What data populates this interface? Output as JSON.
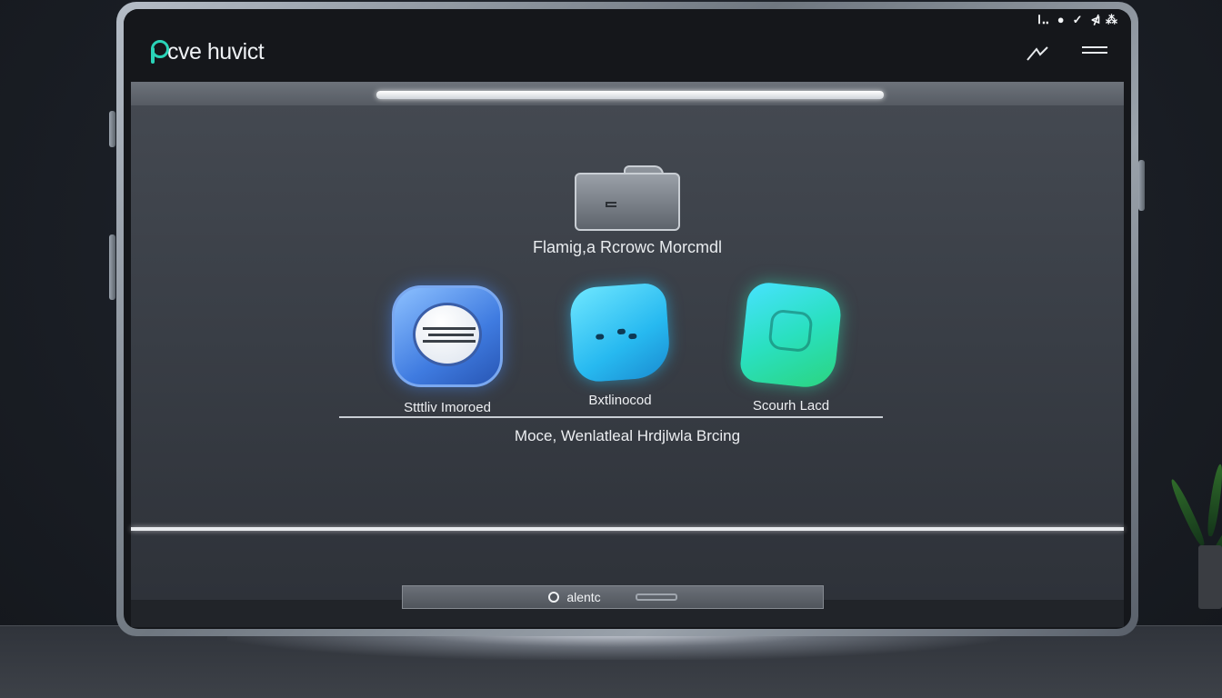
{
  "statusbar": {
    "left": "ꓲꓺ",
    "wifi": "●",
    "signal": "✓",
    "right": "⋪ ⁂"
  },
  "app": {
    "title": "cve huvict"
  },
  "header": {
    "icons": [
      "chart-icon",
      "menu-icon"
    ]
  },
  "progress": {
    "value": 1.0
  },
  "main": {
    "headline": "Flamig,a Rcrowc Morcmdl",
    "tiles": [
      {
        "label": "Stttliv Imoroed",
        "icon": "disc-icon",
        "color": "#3f7be0"
      },
      {
        "label": "Bxtlinocod",
        "icon": "cyan-blob-icon",
        "color": "#27b9f0"
      },
      {
        "label": "Scourh Lacd",
        "icon": "green-shield-icon",
        "color": "#2ad89a"
      }
    ],
    "subline": "Moce, Wenlatleal Hrdjlwla Brcing"
  },
  "footer": {
    "button_label": "alentc"
  },
  "colors": {
    "accent": "#2ad3b8",
    "background": "#1c2027",
    "panel": "#3b4048"
  }
}
